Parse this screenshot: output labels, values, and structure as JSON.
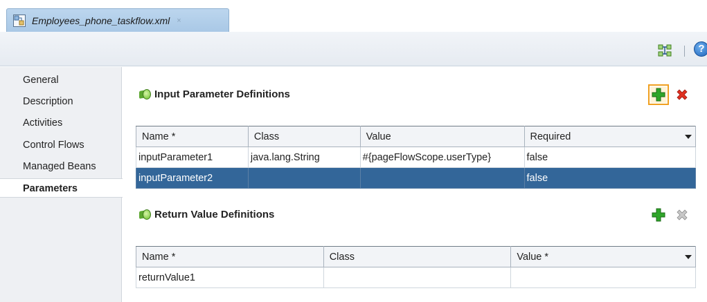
{
  "tab": {
    "title": "Employees_phone_taskflow.xml",
    "close": "×"
  },
  "toolbar": {
    "help_label": "?"
  },
  "sidebar": {
    "items": [
      {
        "label": "General"
      },
      {
        "label": "Description"
      },
      {
        "label": "Activities"
      },
      {
        "label": "Control Flows"
      },
      {
        "label": "Managed Beans"
      },
      {
        "label": "Parameters"
      }
    ],
    "active": "Parameters"
  },
  "input_params": {
    "title": "Input Parameter Definitions",
    "columns": [
      "Name *",
      "Class",
      "Value",
      "Required"
    ],
    "rows": [
      {
        "name": "inputParameter1",
        "class": "java.lang.String",
        "value": "#{pageFlowScope.userType}",
        "required": "false"
      },
      {
        "name": "inputParameter2",
        "class": "",
        "value": "",
        "required": "false"
      }
    ]
  },
  "return_values": {
    "title": "Return Value Definitions",
    "columns": [
      "Name *",
      "Class",
      "Value *"
    ],
    "rows": [
      {
        "name": "returnValue1",
        "class": "",
        "value": ""
      }
    ]
  },
  "colors": {
    "selection": "#336699",
    "add_green": "#2fa52a",
    "delete_red": "#e03020"
  }
}
